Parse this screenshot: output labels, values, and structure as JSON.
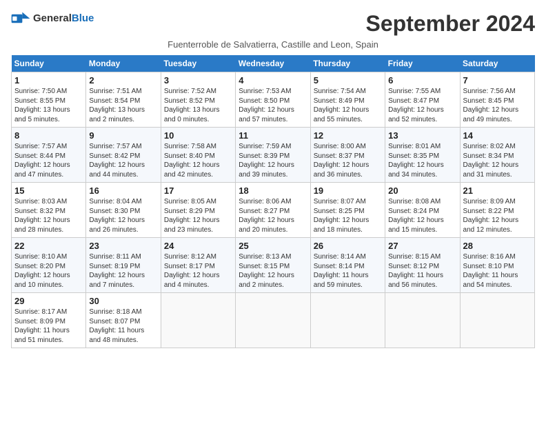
{
  "header": {
    "logo_general": "General",
    "logo_blue": "Blue",
    "title": "September 2024",
    "subtitle": "Fuenterroble de Salvatierra, Castille and Leon, Spain"
  },
  "weekdays": [
    "Sunday",
    "Monday",
    "Tuesday",
    "Wednesday",
    "Thursday",
    "Friday",
    "Saturday"
  ],
  "weeks": [
    [
      {
        "day": "1",
        "detail": "Sunrise: 7:50 AM\nSunset: 8:55 PM\nDaylight: 13 hours\nand 5 minutes."
      },
      {
        "day": "2",
        "detail": "Sunrise: 7:51 AM\nSunset: 8:54 PM\nDaylight: 13 hours\nand 2 minutes."
      },
      {
        "day": "3",
        "detail": "Sunrise: 7:52 AM\nSunset: 8:52 PM\nDaylight: 13 hours\nand 0 minutes."
      },
      {
        "day": "4",
        "detail": "Sunrise: 7:53 AM\nSunset: 8:50 PM\nDaylight: 12 hours\nand 57 minutes."
      },
      {
        "day": "5",
        "detail": "Sunrise: 7:54 AM\nSunset: 8:49 PM\nDaylight: 12 hours\nand 55 minutes."
      },
      {
        "day": "6",
        "detail": "Sunrise: 7:55 AM\nSunset: 8:47 PM\nDaylight: 12 hours\nand 52 minutes."
      },
      {
        "day": "7",
        "detail": "Sunrise: 7:56 AM\nSunset: 8:45 PM\nDaylight: 12 hours\nand 49 minutes."
      }
    ],
    [
      {
        "day": "8",
        "detail": "Sunrise: 7:57 AM\nSunset: 8:44 PM\nDaylight: 12 hours\nand 47 minutes."
      },
      {
        "day": "9",
        "detail": "Sunrise: 7:57 AM\nSunset: 8:42 PM\nDaylight: 12 hours\nand 44 minutes."
      },
      {
        "day": "10",
        "detail": "Sunrise: 7:58 AM\nSunset: 8:40 PM\nDaylight: 12 hours\nand 42 minutes."
      },
      {
        "day": "11",
        "detail": "Sunrise: 7:59 AM\nSunset: 8:39 PM\nDaylight: 12 hours\nand 39 minutes."
      },
      {
        "day": "12",
        "detail": "Sunrise: 8:00 AM\nSunset: 8:37 PM\nDaylight: 12 hours\nand 36 minutes."
      },
      {
        "day": "13",
        "detail": "Sunrise: 8:01 AM\nSunset: 8:35 PM\nDaylight: 12 hours\nand 34 minutes."
      },
      {
        "day": "14",
        "detail": "Sunrise: 8:02 AM\nSunset: 8:34 PM\nDaylight: 12 hours\nand 31 minutes."
      }
    ],
    [
      {
        "day": "15",
        "detail": "Sunrise: 8:03 AM\nSunset: 8:32 PM\nDaylight: 12 hours\nand 28 minutes."
      },
      {
        "day": "16",
        "detail": "Sunrise: 8:04 AM\nSunset: 8:30 PM\nDaylight: 12 hours\nand 26 minutes."
      },
      {
        "day": "17",
        "detail": "Sunrise: 8:05 AM\nSunset: 8:29 PM\nDaylight: 12 hours\nand 23 minutes."
      },
      {
        "day": "18",
        "detail": "Sunrise: 8:06 AM\nSunset: 8:27 PM\nDaylight: 12 hours\nand 20 minutes."
      },
      {
        "day": "19",
        "detail": "Sunrise: 8:07 AM\nSunset: 8:25 PM\nDaylight: 12 hours\nand 18 minutes."
      },
      {
        "day": "20",
        "detail": "Sunrise: 8:08 AM\nSunset: 8:24 PM\nDaylight: 12 hours\nand 15 minutes."
      },
      {
        "day": "21",
        "detail": "Sunrise: 8:09 AM\nSunset: 8:22 PM\nDaylight: 12 hours\nand 12 minutes."
      }
    ],
    [
      {
        "day": "22",
        "detail": "Sunrise: 8:10 AM\nSunset: 8:20 PM\nDaylight: 12 hours\nand 10 minutes."
      },
      {
        "day": "23",
        "detail": "Sunrise: 8:11 AM\nSunset: 8:19 PM\nDaylight: 12 hours\nand 7 minutes."
      },
      {
        "day": "24",
        "detail": "Sunrise: 8:12 AM\nSunset: 8:17 PM\nDaylight: 12 hours\nand 4 minutes."
      },
      {
        "day": "25",
        "detail": "Sunrise: 8:13 AM\nSunset: 8:15 PM\nDaylight: 12 hours\nand 2 minutes."
      },
      {
        "day": "26",
        "detail": "Sunrise: 8:14 AM\nSunset: 8:14 PM\nDaylight: 11 hours\nand 59 minutes."
      },
      {
        "day": "27",
        "detail": "Sunrise: 8:15 AM\nSunset: 8:12 PM\nDaylight: 11 hours\nand 56 minutes."
      },
      {
        "day": "28",
        "detail": "Sunrise: 8:16 AM\nSunset: 8:10 PM\nDaylight: 11 hours\nand 54 minutes."
      }
    ],
    [
      {
        "day": "29",
        "detail": "Sunrise: 8:17 AM\nSunset: 8:09 PM\nDaylight: 11 hours\nand 51 minutes."
      },
      {
        "day": "30",
        "detail": "Sunrise: 8:18 AM\nSunset: 8:07 PM\nDaylight: 11 hours\nand 48 minutes."
      },
      {
        "day": "",
        "detail": ""
      },
      {
        "day": "",
        "detail": ""
      },
      {
        "day": "",
        "detail": ""
      },
      {
        "day": "",
        "detail": ""
      },
      {
        "day": "",
        "detail": ""
      }
    ]
  ]
}
